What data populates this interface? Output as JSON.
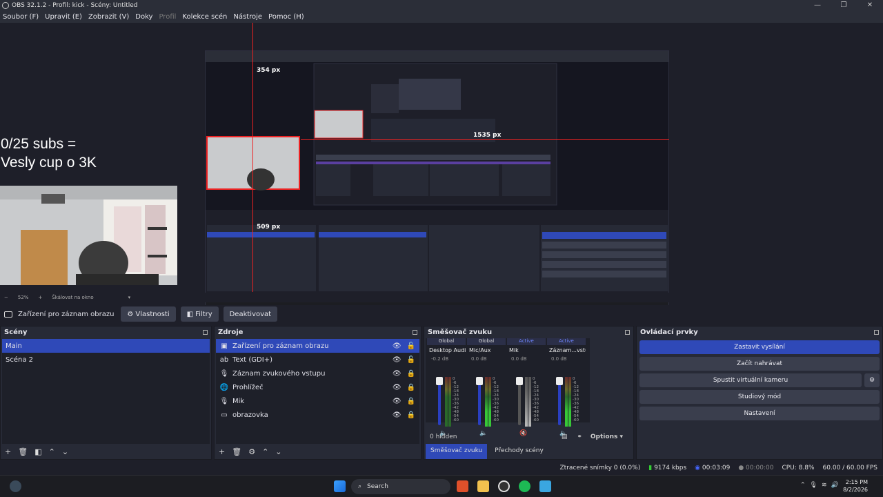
{
  "window": {
    "title": "OBS 32.1.2 - Profil: kick - Scény: Untitled",
    "controls": [
      "—",
      "❐",
      "✕"
    ]
  },
  "menu": [
    "Soubor (F)",
    "Upravit (E)",
    "Zobrazit (V)",
    "Doky",
    "Profil",
    "Kolekce scén",
    "Nástroje",
    "Pomoc (H)"
  ],
  "preview": {
    "overlay_line1": "0/25 subs =",
    "overlay_line2": "Vesly cup o 3K",
    "measure_top": "354 px",
    "measure_bottom": "509 px",
    "measure_right": "1535 px"
  },
  "zoombar": {
    "minus": "−",
    "zoom": "52%",
    "plus": "+",
    "scale_mode": "Škálovat na okno",
    "caret": "▾"
  },
  "source_toolbar": {
    "selected_source": "Zařízení pro záznam obrazu",
    "properties": "Vlastnosti",
    "filters": "Filtry",
    "deactivate": "Deaktivovat"
  },
  "scenes": {
    "title": "Scény",
    "items": [
      "Main",
      "Scéna 2"
    ]
  },
  "sources": {
    "title": "Zdroje",
    "items": [
      {
        "label": "Zařízení pro záznam obrazu",
        "icon": "camera-icon"
      },
      {
        "label": "Text (GDI+)",
        "icon": "text-icon"
      },
      {
        "label": "Záznam zvukového vstupu",
        "icon": "mic-icon"
      },
      {
        "label": "Prohlížeč",
        "icon": "globe-icon"
      },
      {
        "label": "Mik",
        "icon": "mic-icon"
      },
      {
        "label": "obrazovka",
        "icon": "monitor-icon"
      }
    ]
  },
  "mixer": {
    "title": "Směšovač zvuku",
    "channels": [
      {
        "header": "Global",
        "name": "Desktop Audio",
        "db": "-0.2 dB"
      },
      {
        "header": "Global",
        "name": "Mic/Aux",
        "db": "0.0 dB"
      },
      {
        "header": "Active",
        "name": "Mik",
        "db": "0.0 dB"
      },
      {
        "header": "Active",
        "name": "Záznam...vstupu",
        "db": "0.0 dB"
      }
    ],
    "scale": [
      "0",
      "-6",
      "-12",
      "-18",
      "-24",
      "-30",
      "-36",
      "-42",
      "-48",
      "-54",
      "-60"
    ],
    "hidden": "0 hidden",
    "options": "Options",
    "tab_mixer": "Směšovač zvuku",
    "tab_transitions": "Přechody scény"
  },
  "controls": {
    "title": "Ovládací prvky",
    "stop_stream": "Zastavit vysílání",
    "start_record": "Začít nahrávat",
    "virtual_cam": "Spustit virtuální kameru",
    "studio_mode": "Studiový mód",
    "settings": "Nastavení"
  },
  "status": {
    "dropped": "Ztracené snímky 0 (0.0%)",
    "bitrate": "9174 kbps",
    "stream_time": "00:03:09",
    "rec_time": "00:00:00",
    "cpu": "CPU: 8.8%",
    "fps": "60.00 / 60.00 FPS"
  },
  "taskbar": {
    "search": "Search",
    "time": "2:15 PM",
    "date": "8/2/2026"
  },
  "colors": {
    "accent": "#2f49b8",
    "red": "#e22222",
    "panel": "#272a36"
  }
}
